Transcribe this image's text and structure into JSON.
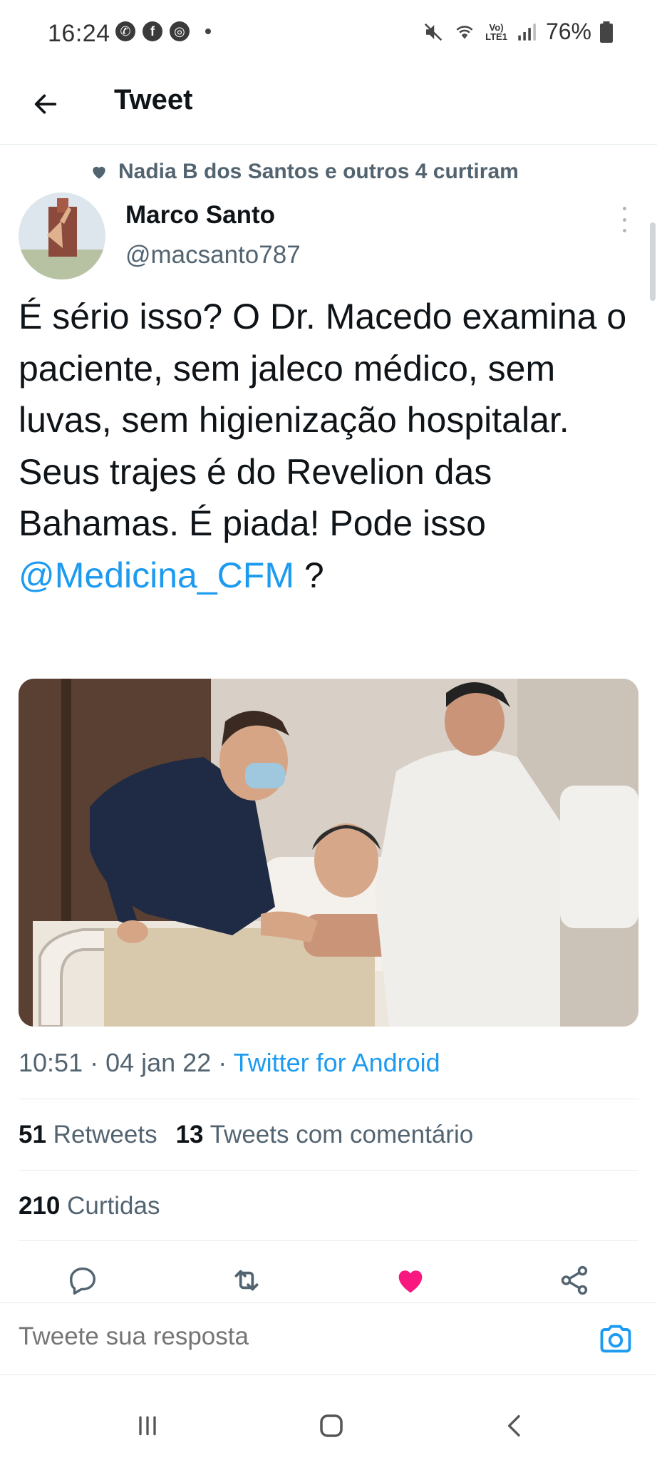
{
  "status_bar": {
    "time": "16:24",
    "battery": "76%",
    "network": "LTE1"
  },
  "header": {
    "title": "Tweet"
  },
  "social_context": {
    "text": "Nadia B dos Santos e outros 4 curtiram"
  },
  "author": {
    "name": "Marco Santo",
    "handle": "@macsanto787"
  },
  "tweet": {
    "text": "É sério isso? O Dr. Macedo examina o paciente, sem jaleco médico, sem luvas, sem higienização hospitalar. Seus trajes é do Revelion das Bahamas. É piada! Pode isso ",
    "mention": "@Medicina_CFM",
    "text_end": " ?"
  },
  "meta": {
    "time": "10:51",
    "date": "04 jan 22",
    "source": "Twitter for Android",
    "sep": " · "
  },
  "stats": {
    "retweets_count": "51",
    "retweets_label": "Retweets",
    "quotes_count": "13",
    "quotes_label": "Tweets com comentário",
    "likes_count": "210",
    "likes_label": "Curtidas"
  },
  "reply": {
    "placeholder": "Tweete sua resposta"
  },
  "colors": {
    "accent": "#1d9bf0",
    "like": "#f91880",
    "text": "#0f1419",
    "muted": "#536471"
  },
  "icons": [
    "back-arrow-icon",
    "heart-icon",
    "more-vertical-icon",
    "reply-icon",
    "retweet-icon",
    "like-icon",
    "share-icon",
    "camera-icon",
    "recents-icon",
    "home-icon",
    "back-nav-icon"
  ]
}
